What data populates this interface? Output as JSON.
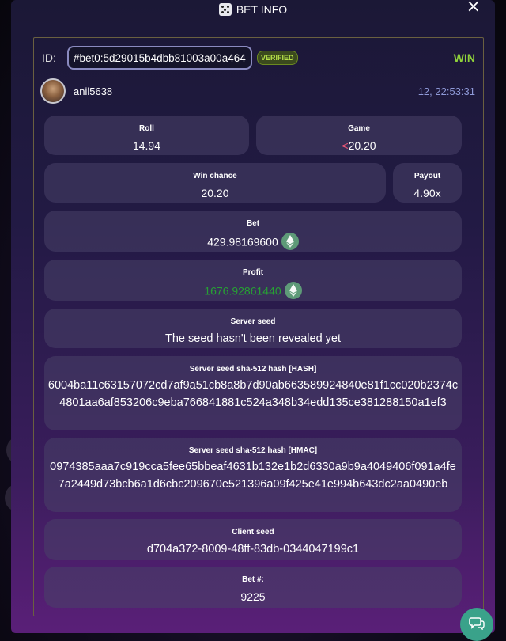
{
  "header": {
    "title": "BET INFO",
    "close_label": "×"
  },
  "bet": {
    "id_label": "ID:",
    "id_value": "#bet0:5d29015b4dbb81003a00a464",
    "verified_badge": "VERIFIED",
    "result": "WIN",
    "username": "anil5638",
    "timestamp": "12, 22:53:31"
  },
  "roll": {
    "label": "Roll",
    "value": "14.94"
  },
  "game": {
    "label": "Game",
    "prefix": "<",
    "value": "20.20"
  },
  "win_chance": {
    "label": "Win chance",
    "value": "20.20"
  },
  "payout": {
    "label": "Payout",
    "value": "4.90x"
  },
  "bet_amount": {
    "label": "Bet",
    "value": "429.98169600",
    "currency_icon": "ethereum-icon"
  },
  "profit": {
    "label": "Profit",
    "value": "1676.92861440",
    "currency_icon": "ethereum-icon"
  },
  "server_seed": {
    "label": "Server seed",
    "value": "The seed hasn't been revealed yet"
  },
  "hash": {
    "label": "Server seed sha-512 hash [HASH]",
    "value": "6004ba11c63157072cd7af9a51cb8a8b7d90ab663589924840e81f1cc020b2374c4801aa6af853206c9eba766841881c524a348b34edd135ce381288150a1ef3"
  },
  "hmac": {
    "label": "Server seed sha-512 hash [HMAC]",
    "value": "0974385aaa7c919cca5fee65bbeaf4631b132e1b2d6330a9b9a4049406f091a4fe7a2449d73bcb6a1d6cbc209670e521396a09f425e41e994b643dc2aa0490eb"
  },
  "client_seed": {
    "label": "Client seed",
    "value": "d704a372-8009-48ff-83db-0344047199c1"
  },
  "bet_number": {
    "label": "Bet #:",
    "value": "9225"
  },
  "colors": {
    "win": "#8fd13a",
    "profit": "#27a034",
    "accent_link": "#8f9ad8",
    "lt_symbol": "#ff5b7a"
  }
}
